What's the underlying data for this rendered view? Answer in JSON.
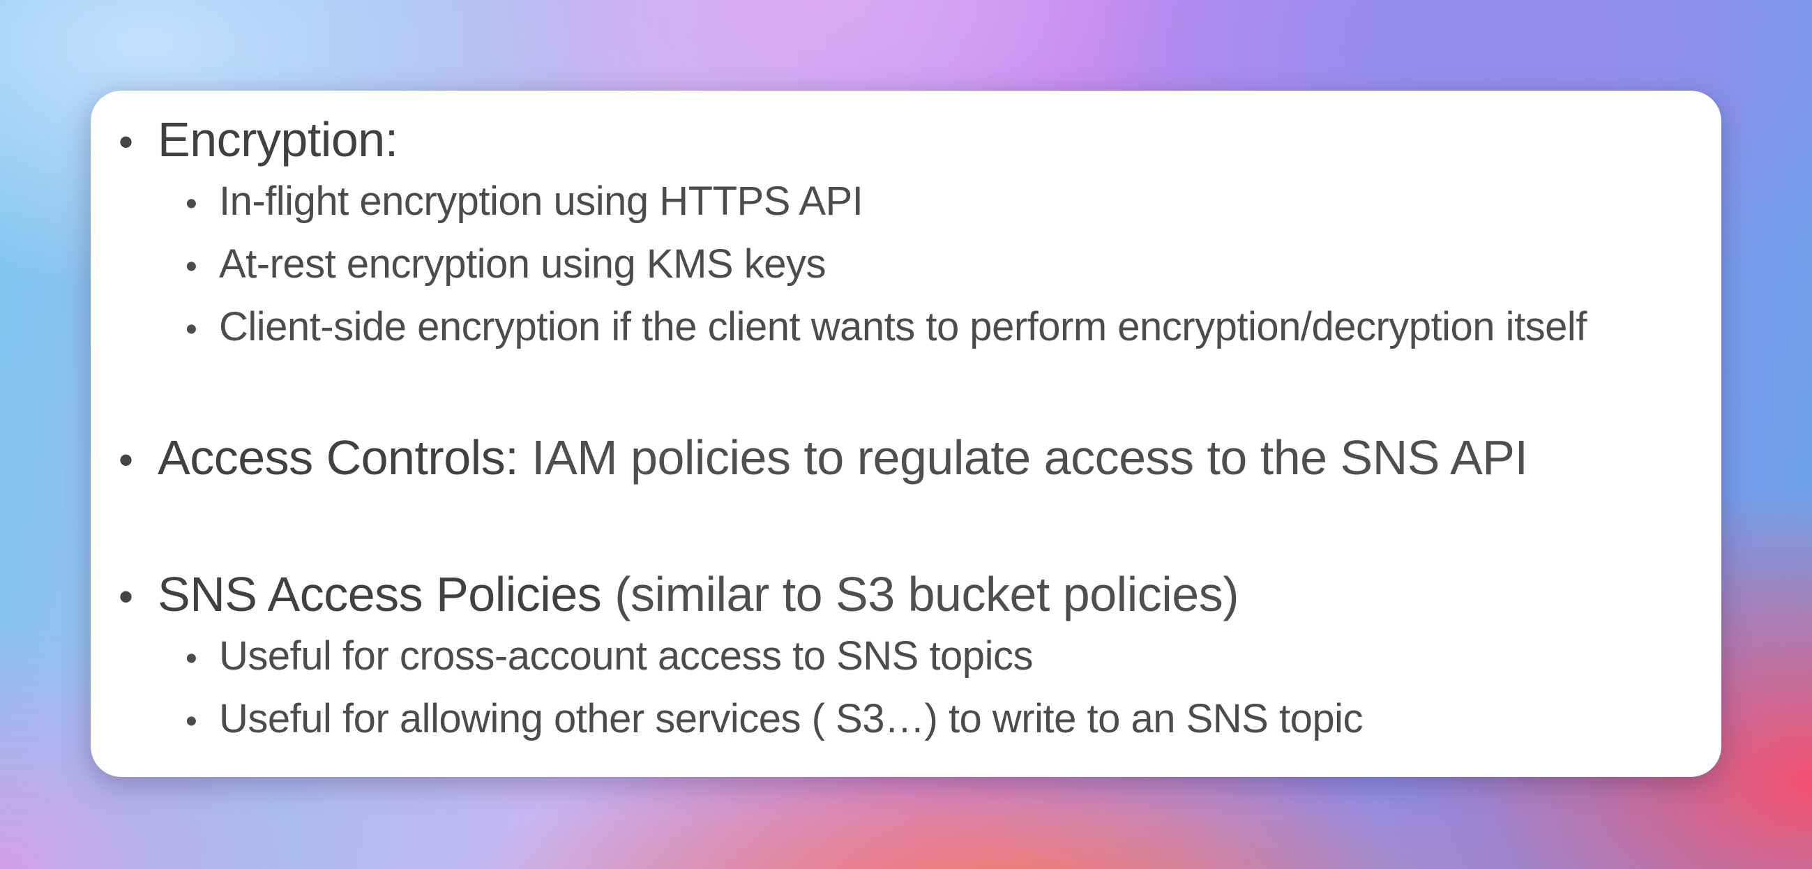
{
  "sections": [
    {
      "title": "Encryption:",
      "rest": "",
      "items": [
        "In-flight encryption using HTTPS API",
        "At-rest encryption using KMS keys",
        "Client-side encryption if the client wants to perform encryption/decryption itself"
      ]
    },
    {
      "title": "Access Controls:",
      "rest": " IAM policies to regulate access to the SNS API",
      "items": []
    },
    {
      "title": "SNS Access Policies",
      "rest": " (similar to S3 bucket policies)",
      "items": [
        "Useful for cross-account access to SNS topics",
        "Useful for allowing other services ( S3…) to write to an SNS topic"
      ]
    }
  ],
  "bullet_glyph": "•"
}
